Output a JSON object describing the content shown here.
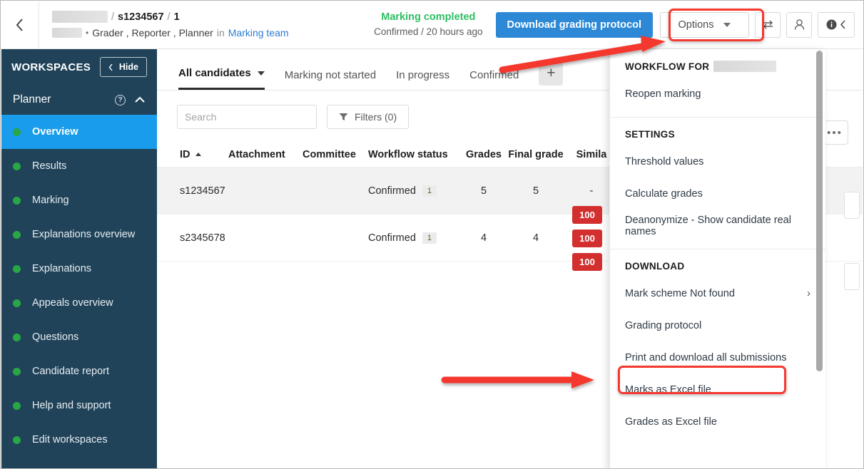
{
  "header": {
    "back_icon": "chevron-left-icon",
    "breadcrumb": {
      "course_redacted": "",
      "sep": "/",
      "candidate_id": "s1234567",
      "attempt": "1",
      "user_redacted": "",
      "bullet": "•",
      "roles": "Grader , Reporter , Planner",
      "in_word": "in",
      "team_link": "Marking team"
    },
    "status": {
      "title": "Marking completed",
      "sub": "Confirmed / 20 hours ago"
    },
    "download_button": "Download grading protocol",
    "options_button": "Options",
    "icons": {
      "swap": "swap-horizontal-icon",
      "user": "user-icon",
      "info": "info-icon",
      "collapse": "chevron-left-icon"
    },
    "colors": {
      "primary": "#2d89d6",
      "success": "#2fbf63",
      "highlight": "#f5392f"
    }
  },
  "sidebar": {
    "title": "WORKSPACES",
    "hide_button": "Hide",
    "group": "Planner",
    "items": [
      {
        "label": "Overview",
        "active": true
      },
      {
        "label": "Results",
        "active": false
      },
      {
        "label": "Marking",
        "active": false
      },
      {
        "label": "Explanations overview",
        "active": false
      },
      {
        "label": "Explanations",
        "active": false
      },
      {
        "label": "Appeals overview",
        "active": false
      },
      {
        "label": "Questions",
        "active": false
      },
      {
        "label": "Candidate report",
        "active": false
      },
      {
        "label": "Help and support",
        "active": false
      },
      {
        "label": "Edit workspaces",
        "active": false
      }
    ],
    "colors": {
      "bg": "#204359",
      "active": "#189ceb",
      "dot": "#28a745"
    }
  },
  "main": {
    "tabs": [
      {
        "label": "All candidates",
        "active": true,
        "has_caret": true
      },
      {
        "label": "Marking not started",
        "active": false,
        "has_caret": false
      },
      {
        "label": "In progress",
        "active": false,
        "has_caret": false
      },
      {
        "label": "Confirmed",
        "active": false,
        "has_caret": false
      }
    ],
    "add_tab_label": "+",
    "search": {
      "placeholder": "Search",
      "value": ""
    },
    "filters_button": "Filters (0)",
    "more_button": "•••",
    "table": {
      "columns": [
        "ID",
        "Attachment",
        "Committee",
        "Workflow status",
        "Grades",
        "Final grade",
        "Simila"
      ],
      "sorted_column": "ID",
      "sort_direction": "asc",
      "rows": [
        {
          "id": "s1234567",
          "attachment": "",
          "committee": "",
          "workflow_status": "Confirmed",
          "workflow_count": "1",
          "grades": "5",
          "final_grade": "5",
          "similarity": "-",
          "badges": []
        },
        {
          "id": "s2345678",
          "attachment": "",
          "committee": "",
          "workflow_status": "Confirmed",
          "workflow_count": "1",
          "grades": "4",
          "final_grade": "4",
          "similarity": "",
          "badges": [
            "100",
            "100",
            "100"
          ]
        }
      ]
    }
  },
  "menu": {
    "sections": [
      {
        "label": "WORKFLOW FOR",
        "label_redacted": true,
        "items": [
          {
            "label": "Reopen marking",
            "submenu": false,
            "highlighted": false
          }
        ]
      },
      {
        "label": "SETTINGS",
        "label_redacted": false,
        "items": [
          {
            "label": "Threshold values",
            "submenu": false,
            "highlighted": false
          },
          {
            "label": "Calculate grades",
            "submenu": false,
            "highlighted": false
          },
          {
            "label": "Deanonymize - Show candidate real names",
            "submenu": false,
            "highlighted": false
          }
        ]
      },
      {
        "label": "DOWNLOAD",
        "label_redacted": false,
        "items": [
          {
            "label": "Mark scheme Not found",
            "submenu": true,
            "highlighted": false
          },
          {
            "label": "Grading protocol",
            "submenu": false,
            "highlighted": false
          },
          {
            "label": "Print and download all submissions",
            "submenu": false,
            "highlighted": true
          },
          {
            "label": "Marks as Excel file",
            "submenu": false,
            "highlighted": false
          },
          {
            "label": "Grades as Excel file",
            "submenu": false,
            "highlighted": false
          }
        ]
      }
    ]
  }
}
